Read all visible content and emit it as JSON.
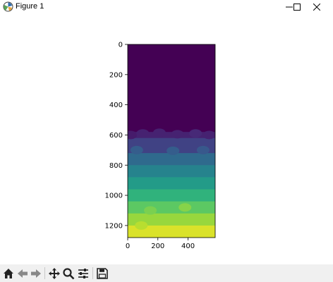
{
  "window": {
    "title": "Figure 1",
    "controls": [
      "minimize",
      "maximize",
      "close"
    ]
  },
  "colors": {
    "background": "#ffffff",
    "toolbar_bg": "#f0f0f0",
    "colormap": "viridis"
  },
  "chart_data": {
    "type": "heatmap",
    "colormap": "viridis",
    "title": "",
    "xlabel": "",
    "ylabel": "",
    "xlim": [
      0,
      580
    ],
    "ylim": [
      1280,
      0
    ],
    "y_axis_inverted": true,
    "x_ticks": [
      "0",
      "200",
      "400"
    ],
    "y_ticks": [
      "0",
      "200",
      "400",
      "600",
      "800",
      "1000",
      "1200"
    ],
    "x_tick_values": [
      0,
      200,
      400
    ],
    "y_tick_values": [
      0,
      200,
      400,
      600,
      800,
      1000,
      1200
    ],
    "value_range": [
      0,
      1
    ],
    "description_rows": {
      "row_breaks": [
        0,
        580,
        620,
        720,
        800,
        880,
        960,
        1040,
        1120,
        1200,
        1280
      ],
      "row_values": [
        0.0,
        0.1,
        0.2,
        0.35,
        0.45,
        0.55,
        0.65,
        0.75,
        0.85,
        0.95
      ]
    }
  },
  "toolbar": {
    "items": [
      "home-icon",
      "back-icon",
      "forward-icon",
      "pan-icon",
      "zoom-icon",
      "configure-icon",
      "save-icon"
    ]
  }
}
